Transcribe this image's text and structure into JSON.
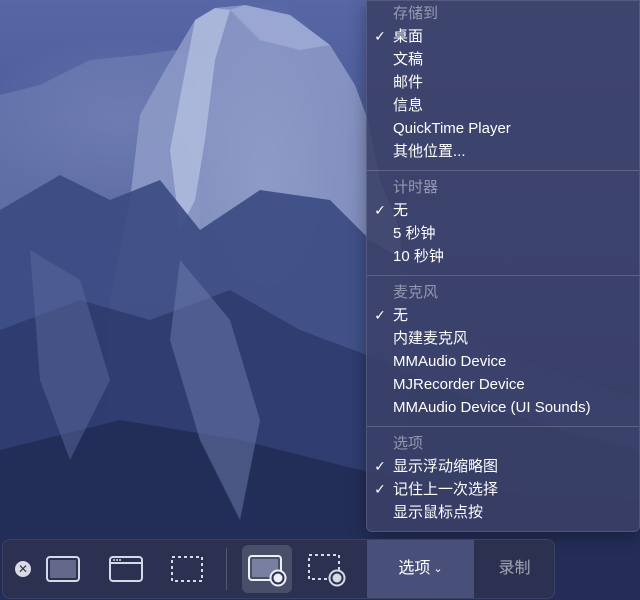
{
  "menu": {
    "sections": [
      {
        "header": "存储到",
        "items": [
          {
            "label": "桌面",
            "checked": true
          },
          {
            "label": "文稿",
            "checked": false
          },
          {
            "label": "邮件",
            "checked": false
          },
          {
            "label": "信息",
            "checked": false
          },
          {
            "label": "QuickTime Player",
            "checked": false
          },
          {
            "label": "其他位置...",
            "checked": false
          }
        ]
      },
      {
        "header": "计时器",
        "items": [
          {
            "label": "无",
            "checked": true
          },
          {
            "label": "5 秒钟",
            "checked": false
          },
          {
            "label": "10 秒钟",
            "checked": false
          }
        ]
      },
      {
        "header": "麦克风",
        "items": [
          {
            "label": "无",
            "checked": true
          },
          {
            "label": "内建麦克风",
            "checked": false
          },
          {
            "label": "MMAudio Device",
            "checked": false
          },
          {
            "label": "MJRecorder Device",
            "checked": false
          },
          {
            "label": "MMAudio Device (UI Sounds)",
            "checked": false
          }
        ]
      },
      {
        "header": "选项",
        "items": [
          {
            "label": "显示浮动缩略图",
            "checked": true
          },
          {
            "label": "记住上一次选择",
            "checked": true
          },
          {
            "label": "显示鼠标点按",
            "checked": false
          }
        ]
      }
    ]
  },
  "toolbar": {
    "close_glyph": "✕",
    "options_label": "选项",
    "options_chevron": "⌄",
    "record_label": "录制"
  },
  "icons": {
    "close": "close-icon",
    "entire_screen": "capture-entire-screen-icon",
    "window": "capture-window-icon",
    "selection": "capture-selection-icon",
    "record_screen": "record-entire-screen-icon",
    "record_selection": "record-selection-icon"
  },
  "colors": {
    "menu_bg": "#3a4066",
    "toolbar_bg": "#2e3250",
    "options_button_bg": "#525a87"
  }
}
